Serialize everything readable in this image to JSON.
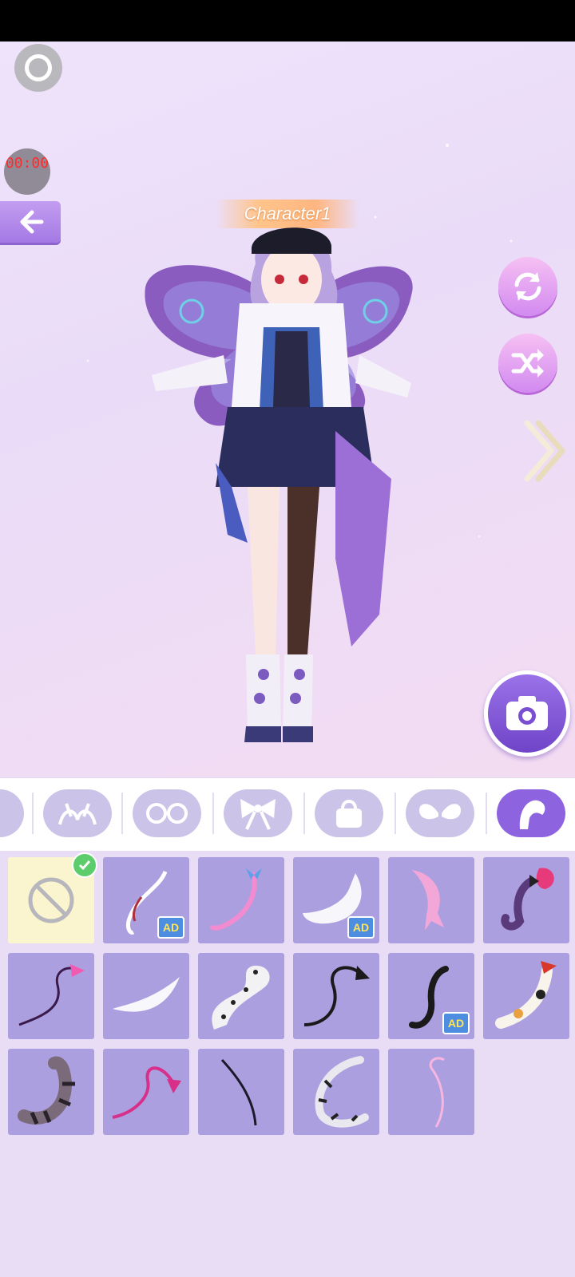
{
  "timer": {
    "text": "00:00"
  },
  "character": {
    "name": "Character1"
  },
  "icons": {
    "record": "record-icon",
    "back": "back-arrow-icon",
    "refresh": "refresh-icon",
    "shuffle": "shuffle-icon",
    "next": "chevron-right-icon",
    "camera": "camera-icon"
  },
  "categories": [
    {
      "name": "partial",
      "icon": "category-icon",
      "active": false
    },
    {
      "name": "headband",
      "icon": "bunny-ears-icon",
      "active": false
    },
    {
      "name": "glasses",
      "icon": "glasses-icon",
      "active": false
    },
    {
      "name": "bow",
      "icon": "bow-icon",
      "active": false
    },
    {
      "name": "bag",
      "icon": "bag-icon",
      "active": false
    },
    {
      "name": "wings",
      "icon": "wings-icon",
      "active": false
    },
    {
      "name": "tail",
      "icon": "tail-icon",
      "active": true
    }
  ],
  "items": [
    {
      "name": "none",
      "selected": true,
      "ad": false
    },
    {
      "name": "ribbon-tail",
      "ad": true,
      "ad_label": "AD"
    },
    {
      "name": "pink-bow-tail",
      "ad": false
    },
    {
      "name": "white-fluffy-tail",
      "ad": true,
      "ad_label": "AD"
    },
    {
      "name": "pink-fish-tail",
      "ad": false
    },
    {
      "name": "purple-bow-tail",
      "ad": false
    },
    {
      "name": "devil-tail-pink",
      "ad": false
    },
    {
      "name": "white-feather-tail",
      "ad": false
    },
    {
      "name": "leopard-tail",
      "ad": false
    },
    {
      "name": "black-devil-tail",
      "ad": false
    },
    {
      "name": "black-cat-tail",
      "ad": true,
      "ad_label": "AD"
    },
    {
      "name": "calico-tail",
      "ad": false
    },
    {
      "name": "striped-cat-tail",
      "ad": false
    },
    {
      "name": "pink-devil-tail",
      "ad": false
    },
    {
      "name": "thin-black-tail",
      "ad": false
    },
    {
      "name": "snow-leopard-tail",
      "ad": false
    },
    {
      "name": "thin-pink-tail",
      "ad": false
    }
  ],
  "colors": {
    "accent": "#8e63e0",
    "item_bg": "#ac9fe0",
    "selected_bg": "#fbf5cf",
    "ad_badge": "#4e8ee0"
  }
}
